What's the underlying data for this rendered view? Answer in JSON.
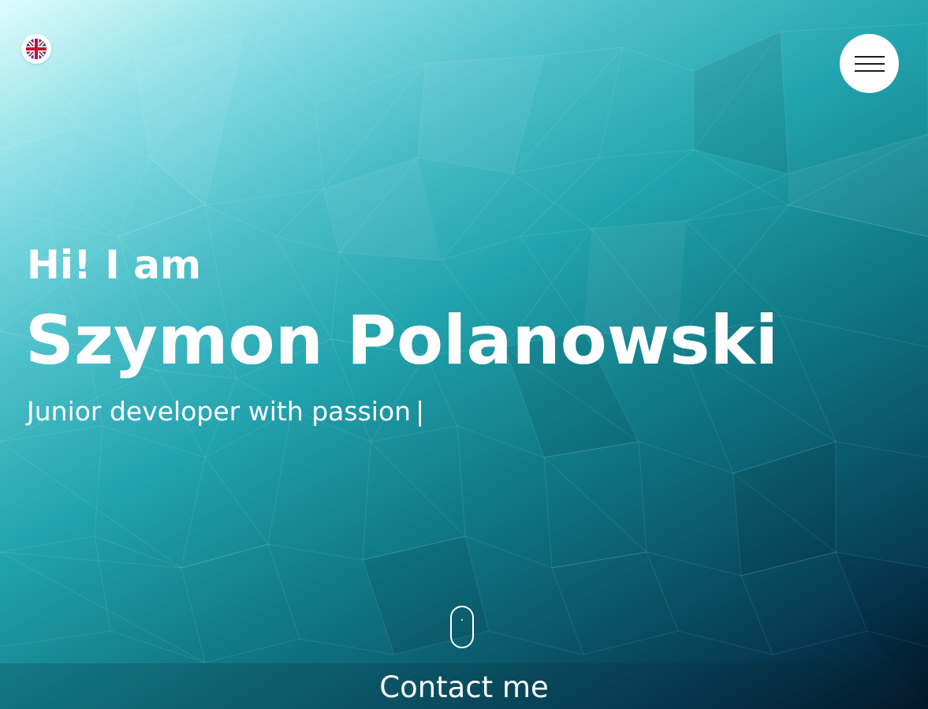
{
  "header": {
    "language_icon": "uk-flag-icon",
    "menu_icon": "hamburger-icon"
  },
  "hero": {
    "greeting": "Hi! I am",
    "name": "Szymon Polanowski",
    "tagline": "Junior developer with passion",
    "caret": "|",
    "scroll_icon": "mouse-scroll-icon"
  },
  "footer": {
    "contact_label": "Contact me"
  },
  "colors": {
    "text": "#ffffff",
    "gradient_light": "#dffcfd",
    "gradient_mid": "#22a3ad",
    "gradient_dark": "#021426",
    "button_bg": "#ffffff",
    "menu_bars": "#1b1b1b"
  }
}
